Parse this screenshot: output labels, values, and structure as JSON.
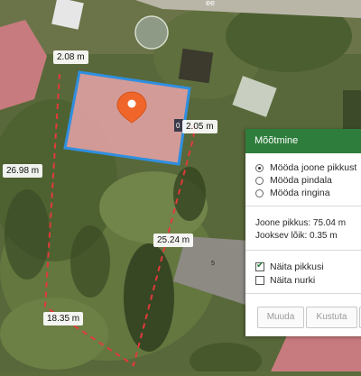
{
  "map": {
    "length_labels": [
      {
        "text": "2.08 m"
      },
      {
        "text": "2.05 m"
      },
      {
        "text": "26.98 m"
      },
      {
        "text": "25.24 m"
      },
      {
        "text": "18.35 m"
      }
    ],
    "building_marker_digit": "0",
    "house_number": "5",
    "street_fragment": "ee",
    "colors": {
      "selection": "#2f8fdf",
      "selection_fill": "#e9a5a8",
      "dashed_line": "#e23a3a",
      "pin": "#f0662a"
    }
  },
  "panel": {
    "title": "Mõõtmine",
    "options": [
      {
        "label": "Mööda joone pikkust",
        "selected": true
      },
      {
        "label": "Mööda pindala",
        "selected": false
      },
      {
        "label": "Mööda ringina",
        "selected": false
      }
    ],
    "line_length": "Joone pikkus: 75.04 m",
    "running_segment": "Jooksev lõik: 0.35 m",
    "checkboxes": [
      {
        "label": "Näita pikkusi",
        "checked": true
      },
      {
        "label": "Näita nurki",
        "checked": false
      }
    ],
    "buttons": {
      "edit": "Muuda",
      "delete": "Kustuta"
    },
    "header_color": "#2e7d3c"
  }
}
